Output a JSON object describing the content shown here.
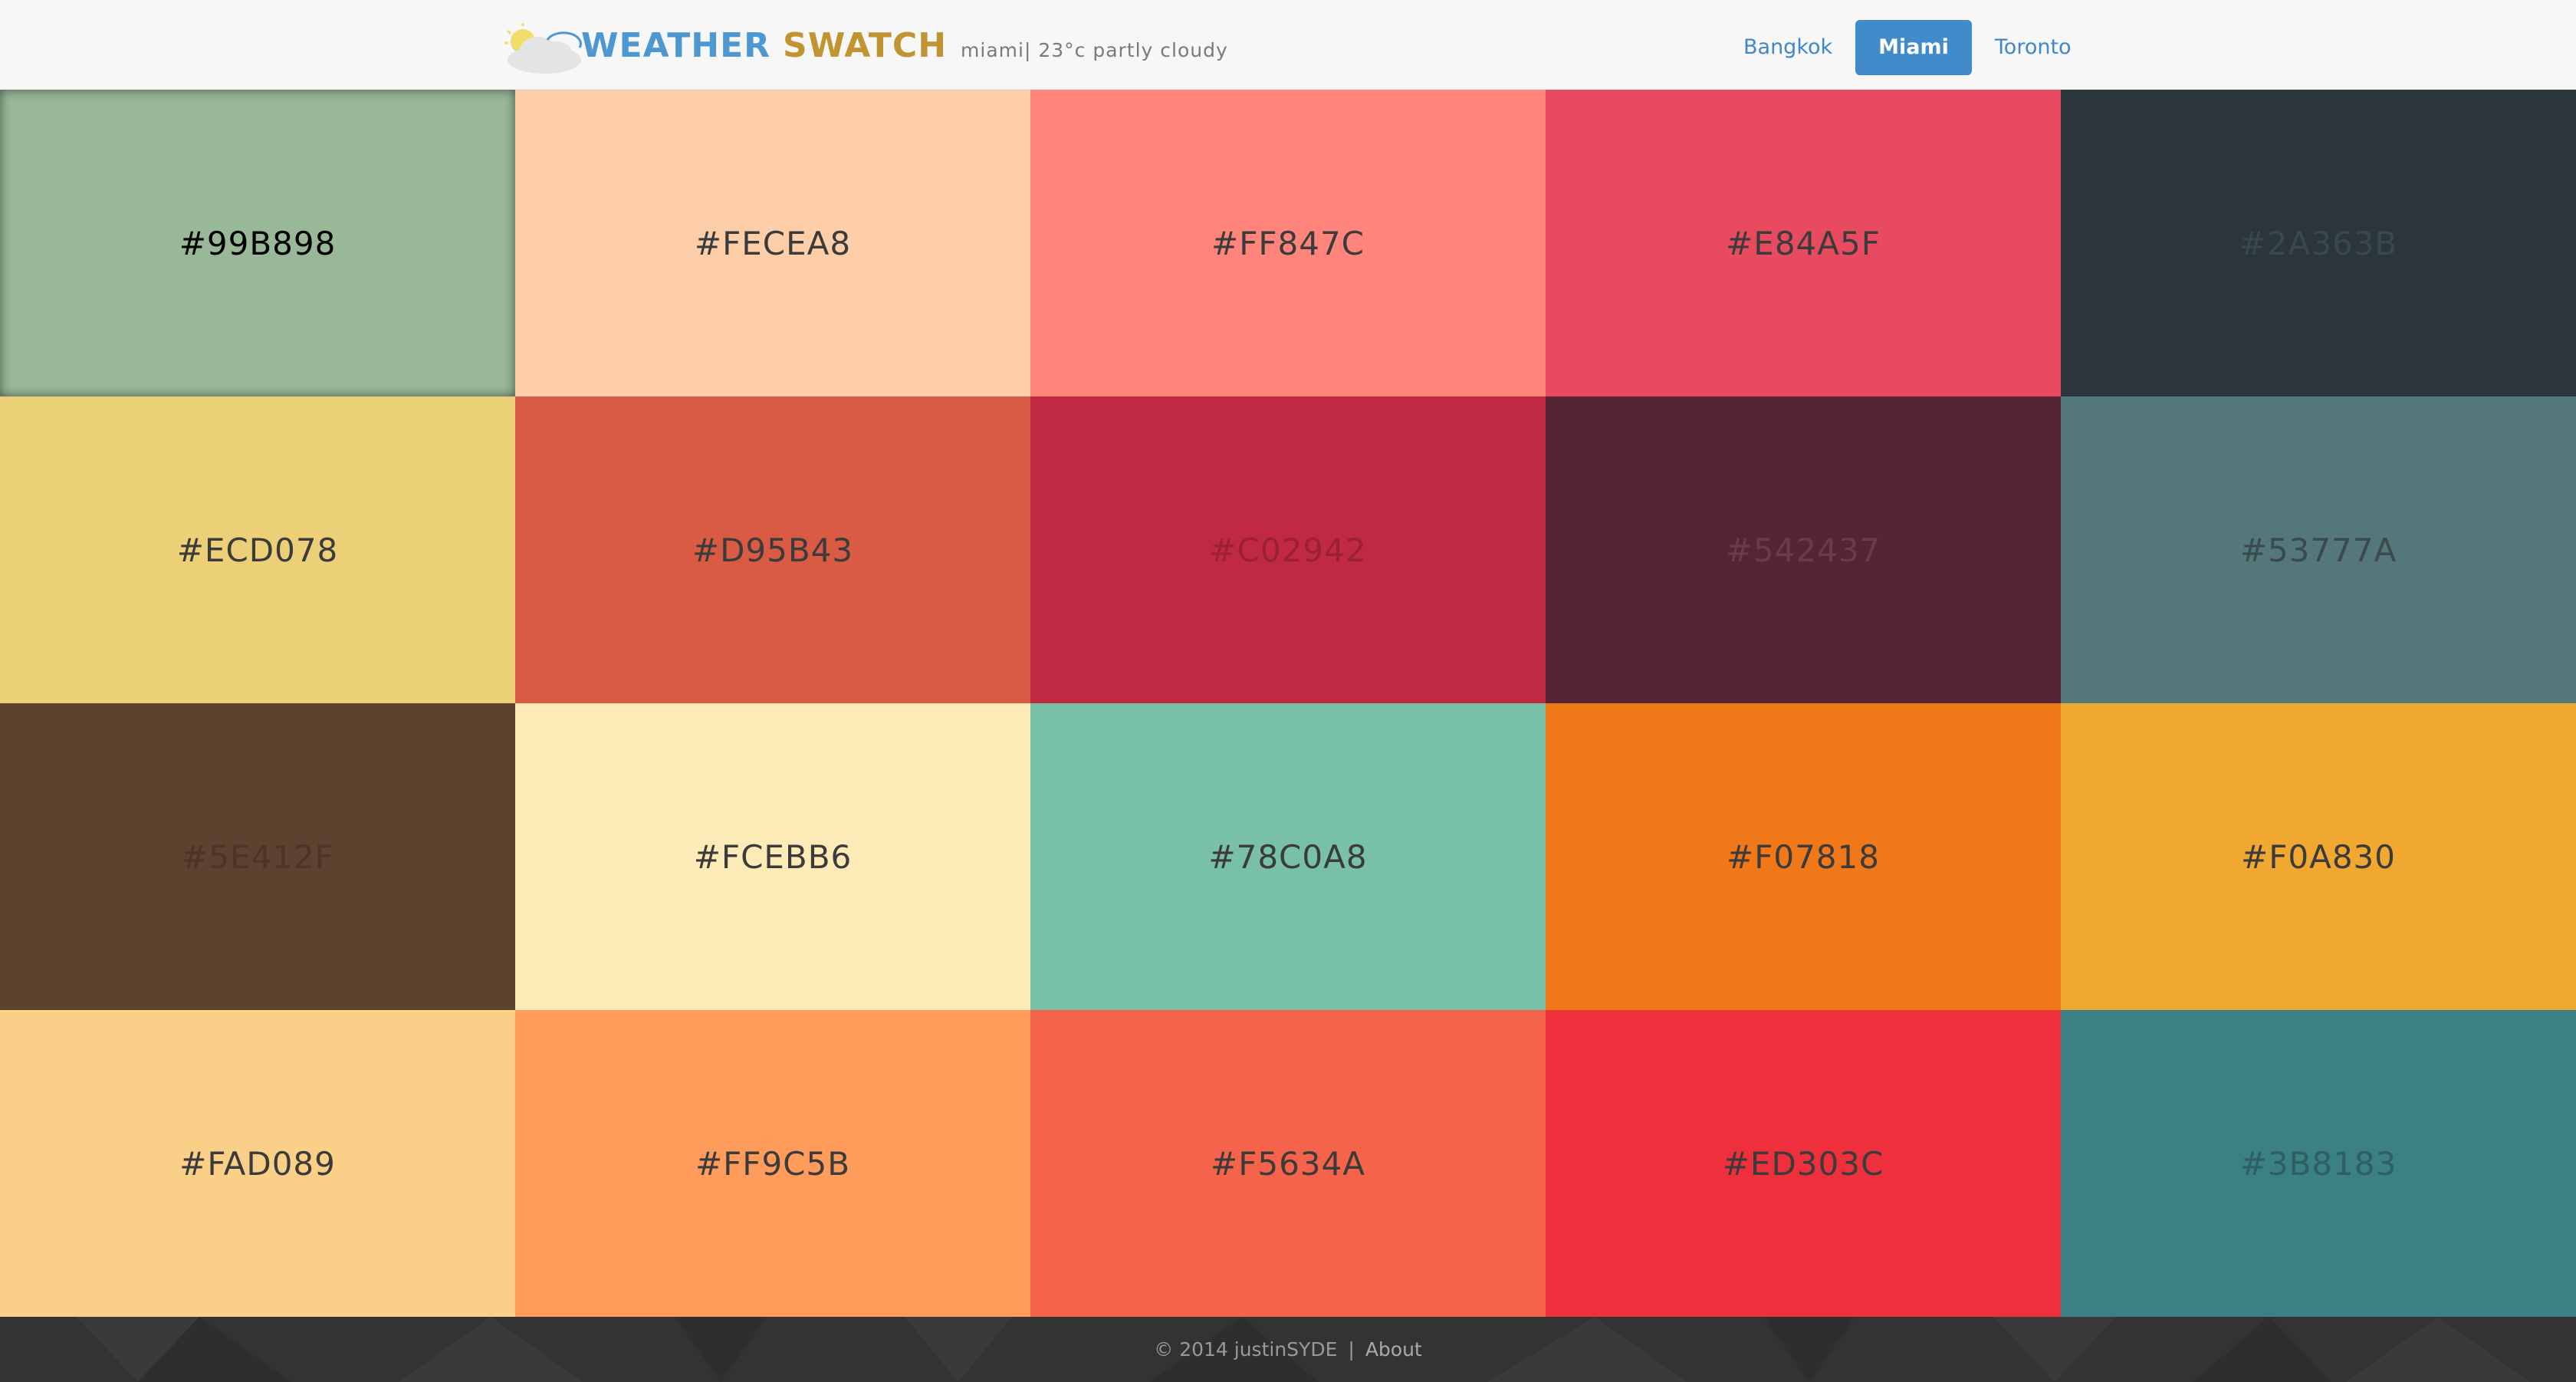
{
  "header": {
    "brand_part1": "WEATHER",
    "brand_part2": "SWATCH",
    "subtitle": "miami| 23°c partly cloudy",
    "logo_icon": "partly-cloudy-icon",
    "nav": [
      {
        "label": "Bangkok",
        "active": false
      },
      {
        "label": "Miami",
        "active": true
      },
      {
        "label": "Toronto",
        "active": false
      }
    ]
  },
  "swatches": [
    {
      "label": "#99B898",
      "color": "#99B898",
      "text_color": "#000000",
      "selected": true
    },
    {
      "label": "#FECEA8",
      "color": "#FECEA8",
      "text_color": "#3b3b3b"
    },
    {
      "label": "#FF847C",
      "color": "#FF847C",
      "text_color": "#3b3b3b"
    },
    {
      "label": "#E84A5F",
      "color": "#E84A5F",
      "text_color": "#3b3b3b"
    },
    {
      "label": "#2A363B",
      "color": "#2A363B",
      "text_color": "#3a474d"
    },
    {
      "label": "#ECD078",
      "color": "#ECD078",
      "text_color": "#3b3b3b"
    },
    {
      "label": "#D95B43",
      "color": "#D95B43",
      "text_color": "#3b3b3b"
    },
    {
      "label": "#C02942",
      "color": "#C02942",
      "text_color": "#9a2035"
    },
    {
      "label": "#542437",
      "color": "#542437",
      "text_color": "#6b3a4c"
    },
    {
      "label": "#53777A",
      "color": "#53777A",
      "text_color": "#3b4a4c"
    },
    {
      "label": "#5E412F",
      "color": "#5E412F",
      "text_color": "#4b3526"
    },
    {
      "label": "#FCEBB6",
      "color": "#FCEBB6",
      "text_color": "#3b3b3b"
    },
    {
      "label": "#78C0A8",
      "color": "#78C0A8",
      "text_color": "#3b3b3b"
    },
    {
      "label": "#F07818",
      "color": "#F07818",
      "text_color": "#3b3b3b"
    },
    {
      "label": "#F0A830",
      "color": "#F0A830",
      "text_color": "#3b3b3b"
    },
    {
      "label": "#FAD089",
      "color": "#FAD089",
      "text_color": "#3b3b3b"
    },
    {
      "label": "#FF9C5B",
      "color": "#FF9C5B",
      "text_color": "#3b3b3b"
    },
    {
      "label": "#F5634A",
      "color": "#F5634A",
      "text_color": "#3b3b3b"
    },
    {
      "label": "#ED303C",
      "color": "#ED303C",
      "text_color": "#3b3b3b"
    },
    {
      "label": "#3B8183",
      "color": "#3B8183",
      "text_color": "#2f5f61"
    }
  ],
  "footer": {
    "copyright": "© 2014 justinSYDE",
    "separator": "|",
    "about_label": "About"
  },
  "colors": {
    "brand_blue": "#4e98d2",
    "brand_gold": "#c09430",
    "nav_active_bg": "#428bca",
    "footer_bg": "#333333"
  }
}
